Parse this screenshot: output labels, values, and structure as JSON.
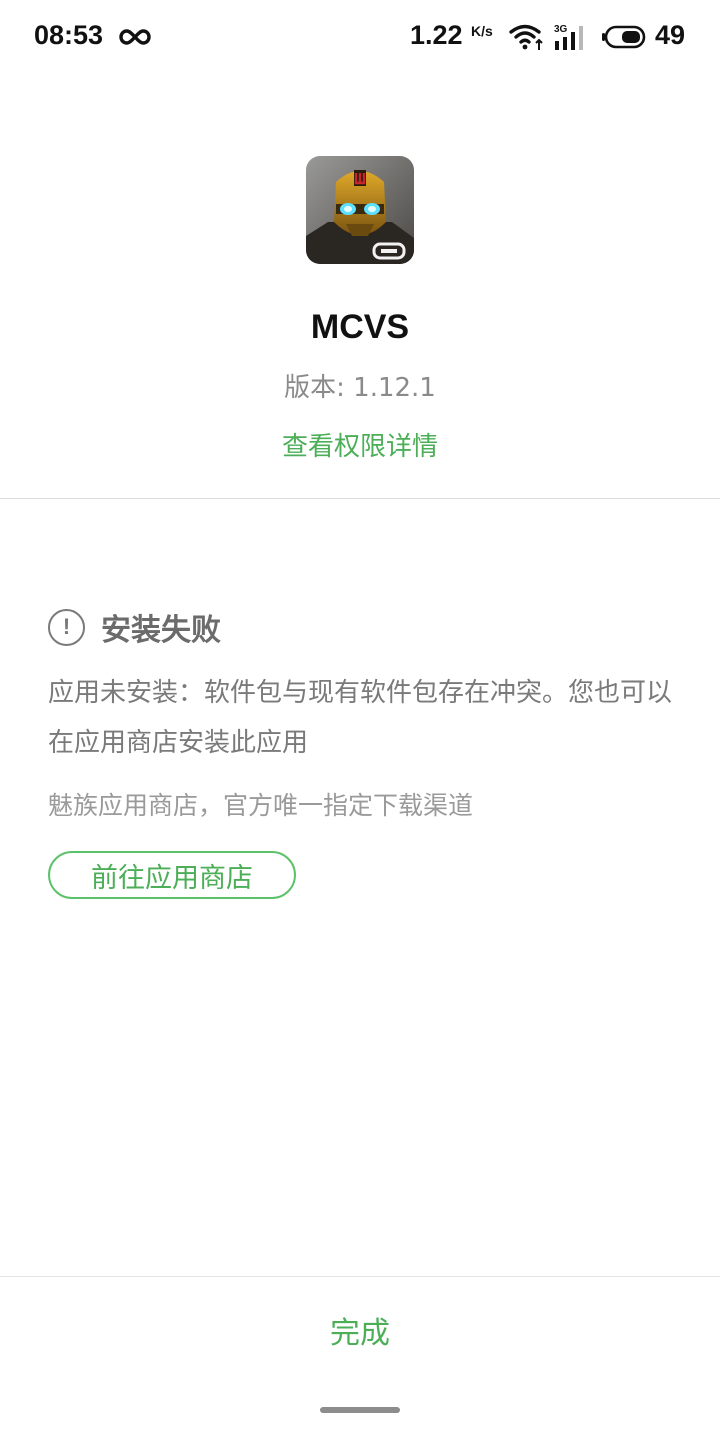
{
  "status_bar": {
    "time": "08:53",
    "net_speed": "1.22",
    "net_speed_unit": "K/s",
    "network_type": "3G",
    "battery": "49",
    "icons": [
      "infinity-icon",
      "wifi-icon",
      "signal-icon",
      "battery-icon"
    ]
  },
  "app": {
    "name": "MCVS",
    "version": "版本: 1.12.1",
    "permission_link": "查看权限详情",
    "icon": "app-icon-robot"
  },
  "result": {
    "title": "安装失败",
    "message": "应用未安装：软件包与现有软件包存在冲突。您也可以在应用商店安装此应用",
    "store_note": "魅族应用商店，官方唯一指定下载渠道",
    "store_button": "前往应用商店"
  },
  "footer": {
    "done_label": "完成"
  },
  "colors": {
    "accent": "#4caf58",
    "muted_text": "#7a7a7a",
    "divider": "#dcdcdc"
  }
}
